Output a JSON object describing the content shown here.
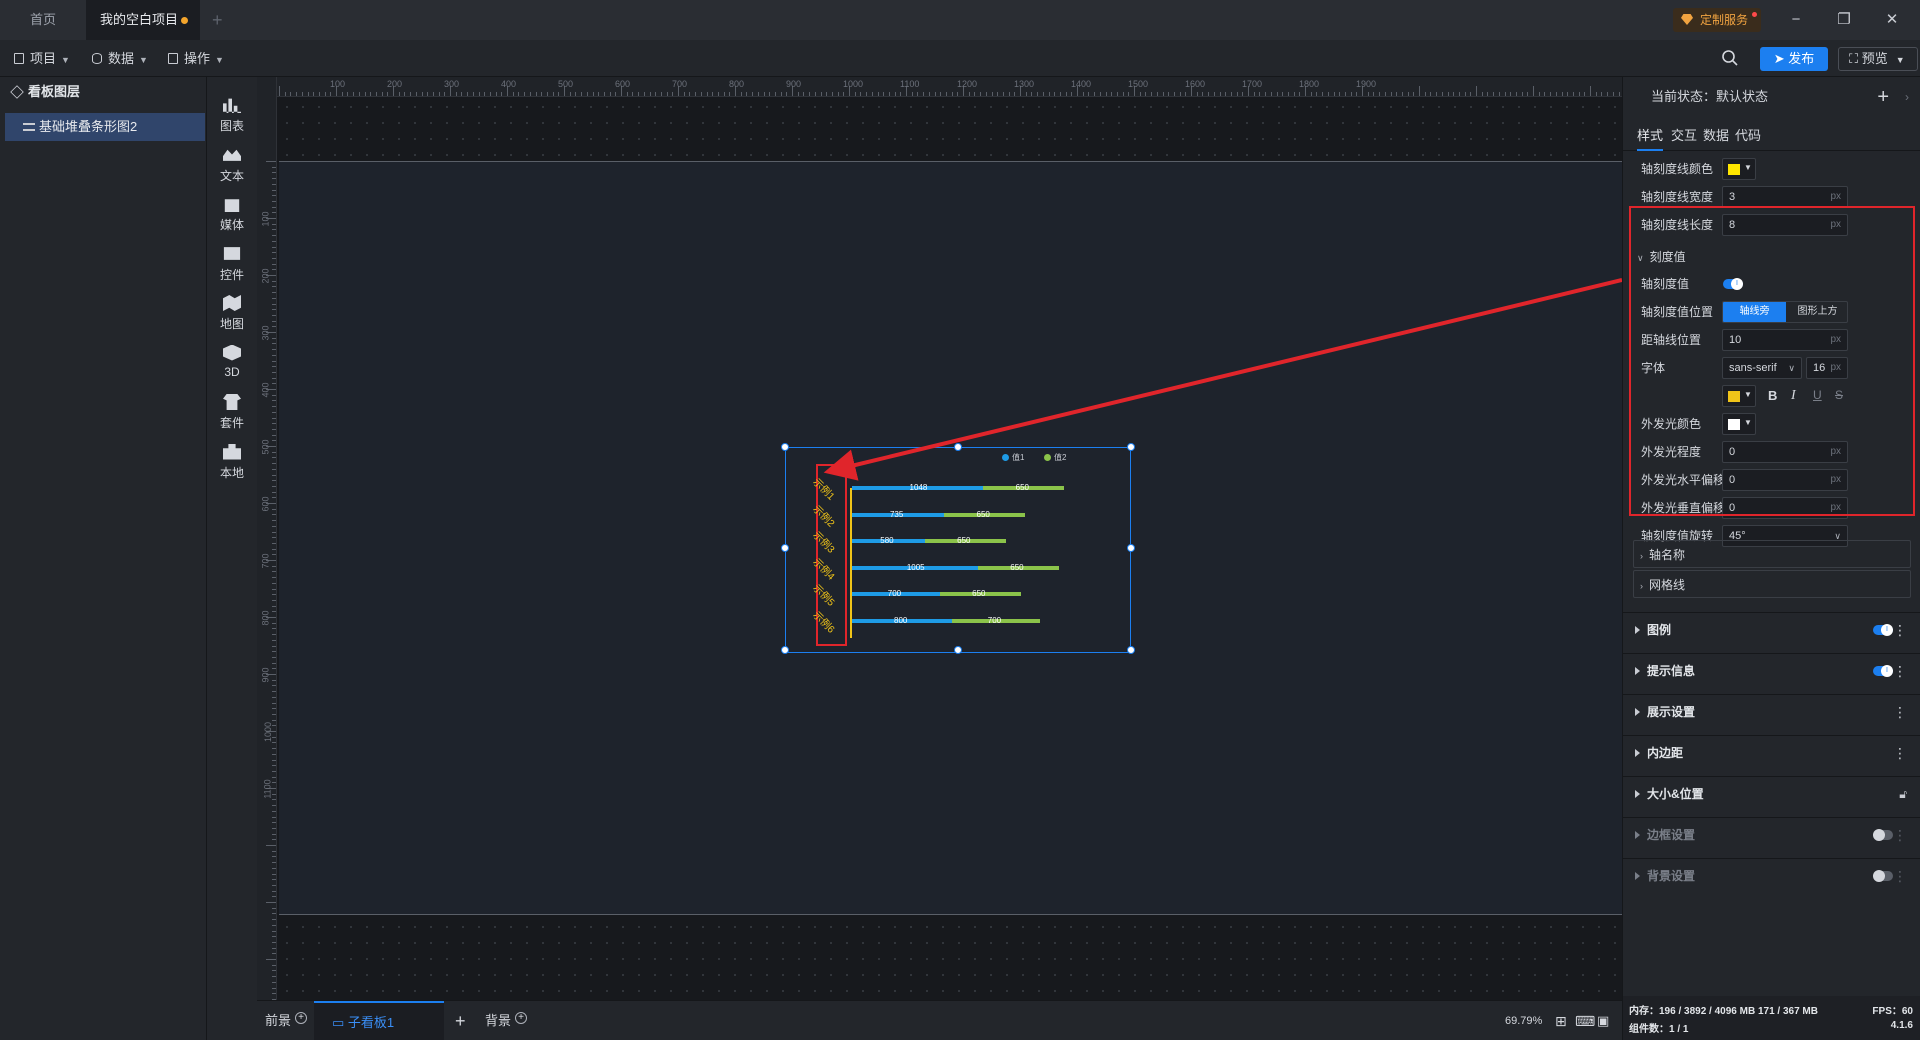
{
  "titlebar": {
    "tabs": [
      {
        "label": "首页"
      },
      {
        "label": "我的空白项目"
      }
    ],
    "custom_service": "定制服务",
    "window_controls": {
      "minimize": "−",
      "maximize": "❐",
      "close": "✕"
    }
  },
  "toolbar": {
    "project": "项目",
    "data": "数据",
    "operation": "操作",
    "publish": "发布",
    "preview": "预览"
  },
  "layers": {
    "title": "看板图层",
    "items": [
      {
        "label": "基础堆叠条形图2"
      }
    ]
  },
  "rail": [
    {
      "label": "图表",
      "icon": "chart-icon"
    },
    {
      "label": "文本",
      "icon": "text-icon"
    },
    {
      "label": "媒体",
      "icon": "media-icon"
    },
    {
      "label": "控件",
      "icon": "control-icon"
    },
    {
      "label": "地图",
      "icon": "map-icon"
    },
    {
      "label": "3D",
      "icon": "cube-icon"
    },
    {
      "label": "套件",
      "icon": "kit-icon"
    },
    {
      "label": "本地",
      "icon": "puzzle-icon"
    }
  ],
  "rulers": {
    "top": [
      "100",
      "200",
      "300",
      "400",
      "500",
      "600",
      "700",
      "800",
      "900",
      "1000",
      "1100",
      "1200",
      "1300",
      "1400",
      "1500",
      "1600",
      "1700",
      "1800",
      "1900"
    ],
    "left": [
      "100",
      "200",
      "300",
      "400",
      "500",
      "600",
      "700",
      "800",
      "900",
      "1000",
      "1100"
    ]
  },
  "chart_data": {
    "type": "bar",
    "orientation": "horizontal",
    "stacked": true,
    "categories": [
      "示例1",
      "示例2",
      "示例3",
      "示例4",
      "示例5",
      "示例6"
    ],
    "series": [
      {
        "name": "值1",
        "values": [
          1048,
          735,
          580,
          1005,
          700,
          800
        ],
        "color": "#1e9be6"
      },
      {
        "name": "值2",
        "values": [
          650,
          650,
          650,
          650,
          650,
          700
        ],
        "color": "#8bc34a"
      }
    ],
    "xlim": [
      0,
      2400
    ],
    "axis_tick_color": "#f0c419",
    "axis_tick_rotation": "45°",
    "legend_position": "top-right"
  },
  "bottombar": {
    "foreground": "前景",
    "child_board": "子看板1",
    "background": "背景",
    "zoom": "69.79%"
  },
  "panel": {
    "current_state": "当前状态：默认状态",
    "tabs": [
      "样式",
      "交互",
      "数据",
      "代码"
    ],
    "tick_line_color_label": "轴刻度线颜色",
    "tick_line_color": "#ffe600",
    "tick_line_width_label": "轴刻度线宽度",
    "tick_line_width": "3",
    "tick_line_length_label": "轴刻度线长度",
    "tick_line_length": "8",
    "unit": "px",
    "tick_value_section": "刻度值",
    "tick_value_label": "轴刻度值",
    "tick_value_pos_label": "轴刻度值位置",
    "tick_value_pos_options": [
      "轴线旁",
      "图形上方"
    ],
    "axis_distance_label": "距轴线位置",
    "axis_distance": "10",
    "font_label": "字体",
    "font_family": "sans-serif",
    "font_size": "16",
    "font_color": "#f0c419",
    "glow_color_label": "外发光颜色",
    "glow_color": "#ffffff",
    "glow_level_label": "外发光程度",
    "glow_level": "0",
    "glow_h_label": "外发光水平偏移",
    "glow_h": "0",
    "glow_v_label": "外发光垂直偏移",
    "glow_v": "0",
    "rotation_label": "轴刻度值旋转",
    "rotation": "45°",
    "axis_name": "轴名称",
    "grid_line": "网格线",
    "groups": [
      {
        "label": "图例",
        "control": "toggle-on"
      },
      {
        "label": "提示信息",
        "control": "toggle-on"
      },
      {
        "label": "展示设置",
        "control": "more"
      },
      {
        "label": "内边距",
        "control": "more"
      },
      {
        "label": "大小&位置",
        "control": "lock"
      },
      {
        "label": "边框设置",
        "control": "toggle-off"
      },
      {
        "label": "背景设置",
        "control": "toggle-off"
      }
    ],
    "status": {
      "memory": "内存：196 / 3892 / 4096 MB  171 / 367 MB",
      "fps": "FPS：60",
      "components": "组件数：1 / 1",
      "version": "4.1.6"
    }
  }
}
